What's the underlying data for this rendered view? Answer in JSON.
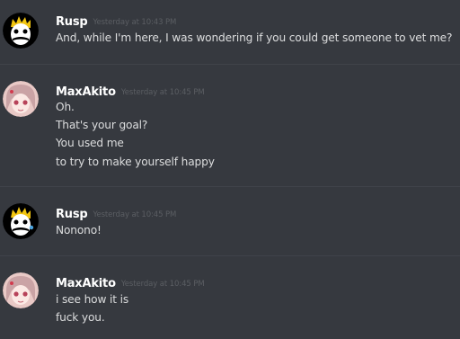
{
  "messages": [
    {
      "username": "Rusp",
      "timestamp": "Yesterday at 10:43 PM",
      "avatar_icon": "spiky-hair-character-avatar-icon",
      "lines": [
        "And, while I'm here, I was wondering if you could get someone to vet me?"
      ]
    },
    {
      "username": "MaxAkito",
      "timestamp": "Yesterday at 10:45 PM",
      "avatar_icon": "anime-girl-avatar-icon",
      "lines": [
        "Oh.",
        "That's your goal?",
        "You used me",
        "to try to make yourself happy"
      ]
    },
    {
      "username": "Rusp",
      "timestamp": "Yesterday at 10:45 PM",
      "avatar_icon": "spiky-hair-character-avatar-icon",
      "lines": [
        "Nonono!"
      ]
    },
    {
      "username": "MaxAkito",
      "timestamp": "Yesterday at 10:45 PM",
      "avatar_icon": "anime-girl-avatar-icon",
      "lines": [
        "i see how it is",
        "fuck you."
      ]
    }
  ],
  "colors": {
    "background": "#36393f",
    "username": "#ffffff",
    "message_text": "#dcddde",
    "timestamp": "#5b5e63",
    "divider": "#40434a"
  }
}
